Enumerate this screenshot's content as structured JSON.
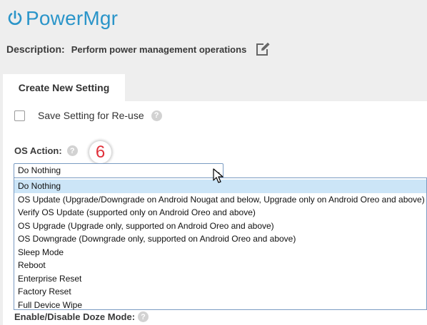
{
  "app": {
    "title": "PowerMgr",
    "icon": "power-icon",
    "accent_color": "#2b95c9"
  },
  "description": {
    "label": "Description:",
    "text": "Perform power management operations",
    "edit_icon": "edit-icon"
  },
  "tabs": [
    {
      "label": "Create New Setting",
      "active": true
    }
  ],
  "save_setting": {
    "label": "Save Setting for Re-use",
    "checked": false
  },
  "os_action": {
    "label": "OS Action:",
    "callout": "6",
    "selected": "Do Nothing",
    "options": [
      "Do Nothing",
      "OS Update (Upgrade/Downgrade on Android Nougat and below, Upgrade only on Android Oreo and above)",
      "Verify OS Update (supported only on Android Oreo and above)",
      "OS Upgrade (Upgrade only, supported on Android Oreo and above)",
      "OS Downgrade (Downgrade only, supported on Android Oreo and above)",
      "Sleep Mode",
      "Reboot",
      "Enterprise Reset",
      "Factory Reset",
      "Full Device Wipe"
    ]
  },
  "doze": {
    "label": "Enable/Disable Doze Mode:"
  },
  "help_glyph": "?",
  "colors": {
    "selected_option_bg": "#cce5f7",
    "callout_number": "#e0303a"
  }
}
